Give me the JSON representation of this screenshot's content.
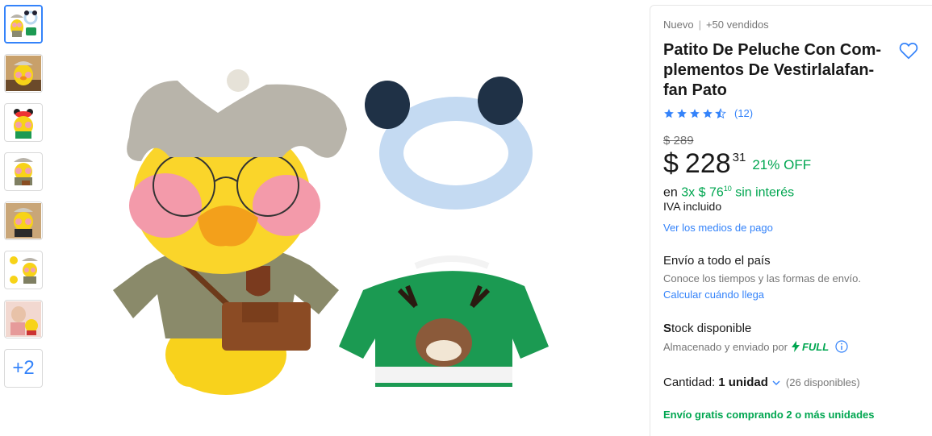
{
  "thumbnails": {
    "count": 7,
    "more_label": "+2"
  },
  "product": {
    "condition": "Nuevo",
    "separator": "|",
    "sold": "+50 vendidos",
    "title": "Patito De Peluche Con Com-plementos De Vestirlalafan-fan Pato",
    "rating_value": 4.5,
    "reviews_count": "(12)",
    "original_price": "$ 289",
    "currency_symbol": "$",
    "price_integer": "228",
    "price_cents": "31",
    "discount": "21% OFF",
    "installments_prefix": "en",
    "installments_text": "3x $ 76",
    "installments_cents": "10",
    "installments_suffix": "sin interés",
    "iva": "IVA incluido",
    "payment_link": "Ver los medios de pago"
  },
  "shipping": {
    "title": "Envío a todo el país",
    "subtitle": "Conoce los tiempos y las formas de envío.",
    "link": "Calcular cuándo llega"
  },
  "stock": {
    "title_first": "S",
    "title_rest": "tock disponible",
    "stored_by": "Almacenado y enviado por",
    "full_label": "FULL"
  },
  "quantity": {
    "label": "Cantidad:",
    "value": "1 unidad",
    "available": "(26 disponibles)"
  },
  "free_shipping": "Envío gratis comprando 2 o más unidades",
  "colors": {
    "accent": "#3483fa",
    "green": "#00a650"
  },
  "icons": [
    "heart-icon",
    "star-icon",
    "lightning-icon",
    "info-icon",
    "chevron-down-icon"
  ]
}
